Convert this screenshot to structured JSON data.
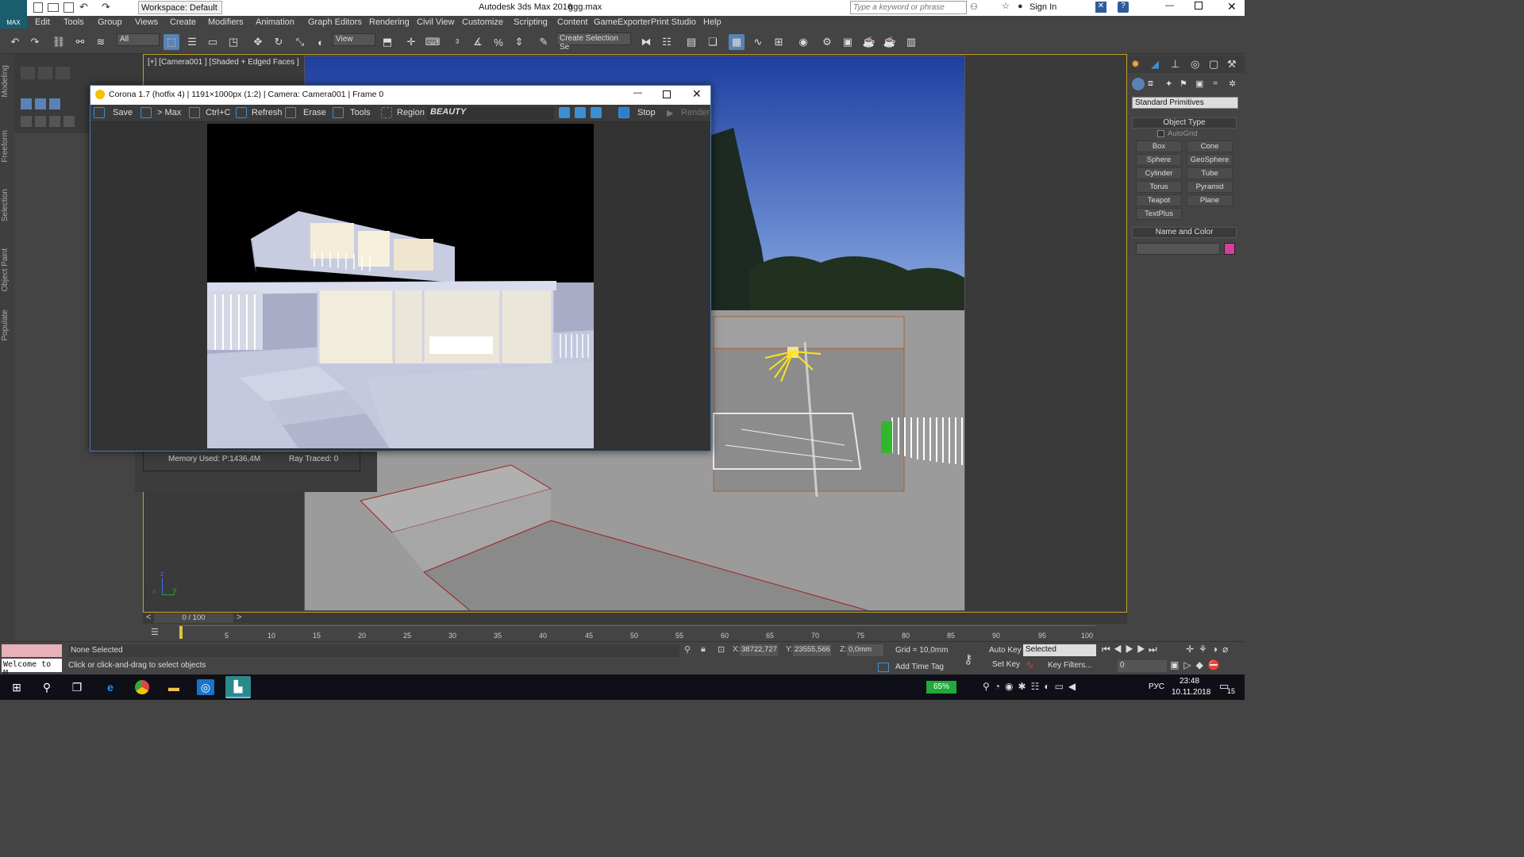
{
  "app": {
    "title": "Autodesk 3ds Max 2016",
    "file": "ggg.max",
    "workspace": "Workspace: Default",
    "search_placeholder": "Type a keyword or phrase",
    "sign_in": "Sign In",
    "logo_label": "MAX"
  },
  "menu": [
    "Edit",
    "Tools",
    "Group",
    "Views",
    "Create",
    "Modifiers",
    "Animation",
    "Graph Editors",
    "Rendering",
    "Civil View",
    "Customize",
    "Scripting",
    "Content",
    "GameExporter",
    "Print Studio",
    "Help"
  ],
  "toolbar": {
    "selection_filter": "All",
    "ref_coord": "View",
    "named_selection": "Create Selection Se"
  },
  "left_tabs": [
    "Modeling",
    "Freeform",
    "Selection",
    "Object Paint",
    "Populate"
  ],
  "viewport": {
    "label": "[+] [Camera001 ] [Shaded + Edged Faces ]",
    "axis_x": "x",
    "axis_y": "y",
    "axis_z": "z"
  },
  "corona": {
    "title": "Corona 1.7 (hotfix 4) | 1191×1000px (1:2) | Camera: Camera001 | Frame 0",
    "save": "Save",
    "to_max": "> Max",
    "copy": "Ctrl+C",
    "refresh": "Refresh",
    "erase": "Erase",
    "tools": "Tools",
    "region": "Region",
    "channel": "BEAUTY",
    "stop": "Stop",
    "render": "Render"
  },
  "stats": {
    "memory": "Memory Used: P:1436,4M",
    "ray": "Ray Traced: 0"
  },
  "command_panel": {
    "dropdown": "Standard Primitives",
    "object_type": "Object Type",
    "autogrid": "AutoGrid",
    "buttons": [
      "Box",
      "Cone",
      "Sphere",
      "GeoSphere",
      "Cylinder",
      "Tube",
      "Torus",
      "Pyramid",
      "Teapot",
      "Plane",
      "TextPlus"
    ],
    "name_color": "Name and Color",
    "swatch": "#d63ea0"
  },
  "timeline": {
    "frame": "0 / 100",
    "ticks": [
      "5",
      "10",
      "15",
      "20",
      "25",
      "30",
      "35",
      "40",
      "45",
      "50",
      "55",
      "60",
      "65",
      "70",
      "75",
      "80",
      "85",
      "90",
      "95",
      "100"
    ]
  },
  "status": {
    "script": "Welcome to M",
    "selection": "None Selected",
    "prompt": "Click or click-and-drag to select objects",
    "x_label": "X:",
    "x": "38722,727",
    "y_label": "Y:",
    "y": "23555,566",
    "z_label": "Z:",
    "z": "0,0mm",
    "grid": "Grid = 10,0mm",
    "add_time_tag": "Add Time Tag",
    "auto_key": "Auto Key",
    "set_key": "Set Key",
    "key_mode": "Selected",
    "key_filters": "Key Filters...",
    "frame_field": "0"
  },
  "taskbar": {
    "battery": "65%",
    "lang": "РУС",
    "time": "23:48",
    "date": "10.11.2018",
    "notif": "15"
  }
}
